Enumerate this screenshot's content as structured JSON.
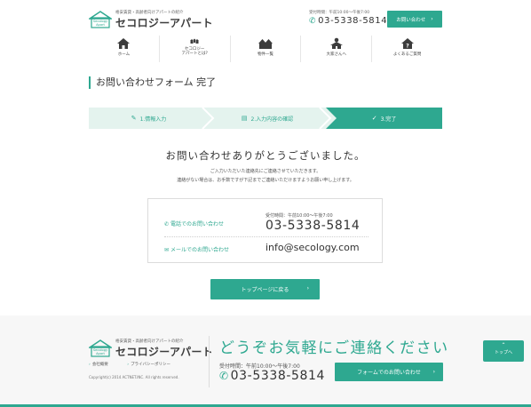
{
  "header": {
    "logo_tagline": "格安賃貸・高齢者向けアパートの紹介",
    "logo_brand": "セコロジーアパート",
    "logo_badge": "Secology Apart",
    "hours": "受付時間：午前10:00～午後7:00",
    "phone": "03-5338-5814",
    "contact_button": "お問い合わせ",
    "nav": [
      {
        "label": "ホーム",
        "icon": "house-icon"
      },
      {
        "label": "セコロジー\nアパートとは?",
        "icon": "secology-icon"
      },
      {
        "label": "物件一覧",
        "icon": "buildings-icon"
      },
      {
        "label": "大家さんへ",
        "icon": "landlord-icon"
      },
      {
        "label": "よくあるご質問",
        "icon": "faq-house-icon"
      }
    ]
  },
  "page_title": "お問い合わせフォーム 完了",
  "steps": [
    {
      "label": "1.情報入力",
      "icon": "pencil-icon"
    },
    {
      "label": "2.入力内容の確認",
      "icon": "document-icon"
    },
    {
      "label": "3.完了",
      "icon": "check-circle-icon"
    }
  ],
  "thanks": {
    "heading": "お問い合わせありがとうございました。",
    "line1": "ご入力いただいた連絡先にご連絡させていただきます。",
    "line2": "連絡がない場合は、お手数ですが下記までご連絡いただけますようお願い申し上げます。"
  },
  "contact_box": {
    "phone_label": "電話でのお問い合わせ",
    "hours": "受付時間：午前10:00～午後7:00",
    "phone": "03-5338-5814",
    "mail_label": "メールでのお問い合わせ",
    "email": "info@secology.com"
  },
  "top_button": "トップページに戻る",
  "footer": {
    "logo_tagline": "格安賃貸・高齢者向けアパートの紹介",
    "logo_brand": "セコロジーアパート",
    "links": [
      "会社概要",
      "プライバシーポリシー"
    ],
    "copyright": "Copyright(c) 2014 ACTNET.INC. All rights reserved.",
    "catch": "どうぞお気軽にご連絡ください",
    "hours": "受付時間：午前10:00～午後7:00",
    "phone": "03-5338-5814",
    "form_button": "フォームでのお問い合わせ",
    "to_top": "トップへ"
  },
  "colors": {
    "accent": "#2ea890",
    "accent_light": "#e4f3ee"
  }
}
